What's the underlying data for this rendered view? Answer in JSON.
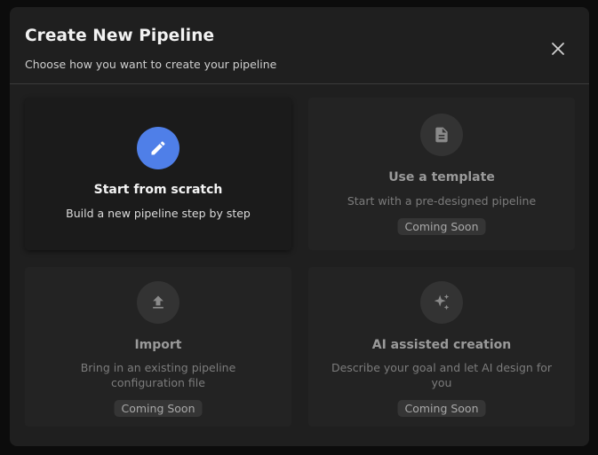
{
  "dialog": {
    "title": "Create New Pipeline",
    "subtitle": "Choose how you want to create your pipeline"
  },
  "options": [
    {
      "title": "Start from scratch",
      "description": "Build a new pipeline step by step",
      "icon": "pencil-icon",
      "badge": ""
    },
    {
      "title": "Use a template",
      "description": "Start with a pre-designed pipeline",
      "icon": "document-icon",
      "badge": "Coming Soon"
    },
    {
      "title": "Import",
      "description": "Bring in an existing pipeline configuration file",
      "icon": "upload-icon",
      "badge": "Coming Soon"
    },
    {
      "title": "AI assisted creation",
      "description": "Describe your goal and let AI design for you",
      "icon": "sparkles-icon",
      "badge": "Coming Soon"
    }
  ],
  "colors": {
    "accent": "#4f7fe8",
    "dialog_bg": "#1f1f1f",
    "card_bg": "#232323"
  }
}
